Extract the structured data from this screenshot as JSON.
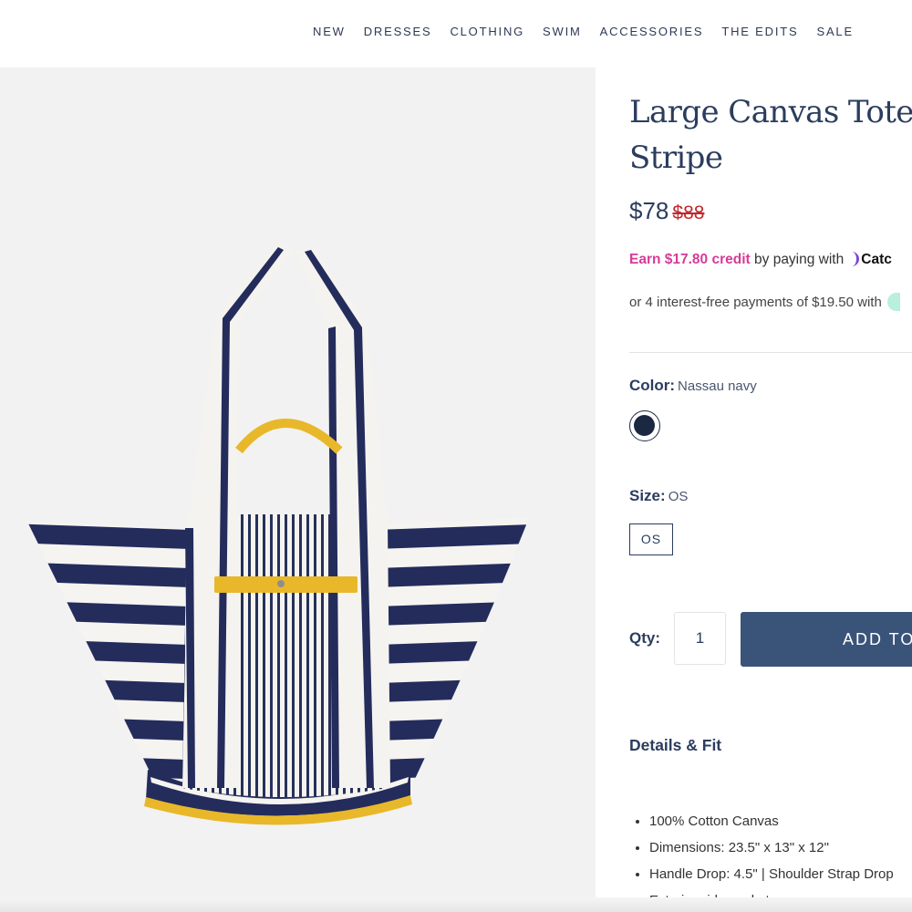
{
  "nav": {
    "items": [
      "NEW",
      "DRESSES",
      "CLOTHING",
      "SWIM",
      "ACCESSORIES",
      "THE EDITS",
      "SALE"
    ]
  },
  "product": {
    "title_line1": "Large Canvas Tote",
    "title_line2": "Stripe",
    "price_now": "$78",
    "price_was": "$88",
    "catch": {
      "credit": "Earn $17.80 credit",
      "paying_with": "by paying with",
      "brand": "Catc"
    },
    "installments": "or 4 interest-free payments of $19.50 with",
    "color": {
      "key": "Color:",
      "value": "Nassau navy",
      "swatch_hex": "#1b2842"
    },
    "size": {
      "key": "Size:",
      "value": "OS",
      "option": "OS"
    },
    "qty": {
      "label": "Qty:",
      "value": "1"
    },
    "add_button": "ADD TO",
    "details": {
      "heading": "Details & Fit",
      "bullets": [
        "100% Cotton Canvas",
        "Dimensions: 23.5\" x 13\" x 12\"",
        "Handle Drop: 4.5\" | Shoulder Strap Drop",
        "Exterior side pocket"
      ]
    }
  },
  "colors": {
    "navy": "#2b3d5e",
    "button": "#3a5479",
    "sale_red": "#c0282d",
    "credit_pink": "#d63b9a",
    "bag_yellow": "#e8b82a"
  }
}
